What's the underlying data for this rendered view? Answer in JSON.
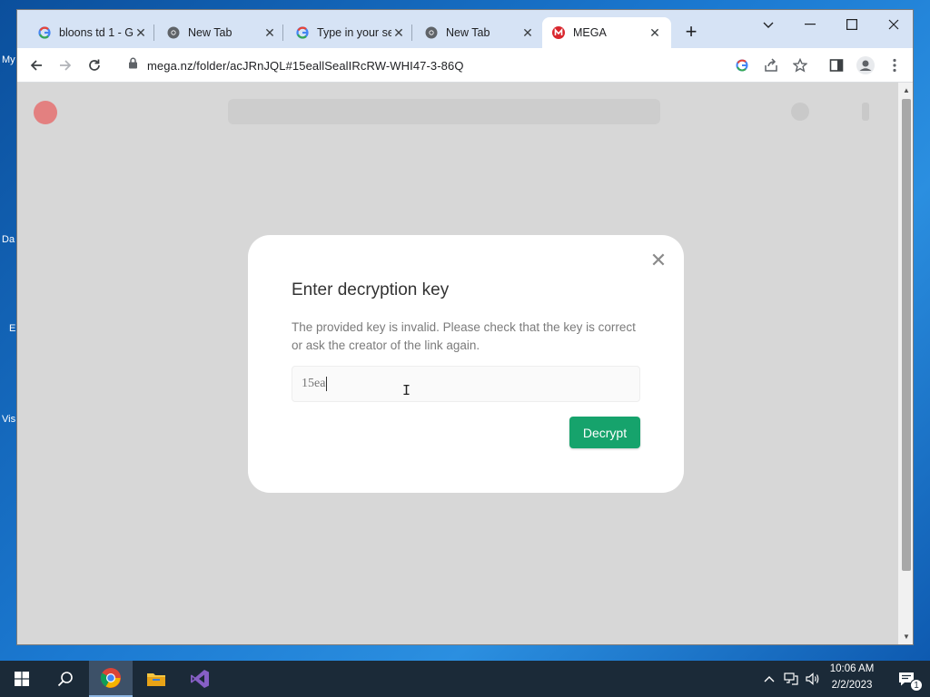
{
  "desktop": {
    "icon_labels": [
      "My",
      "Da",
      "E",
      "Vis"
    ]
  },
  "browser": {
    "tabs": [
      {
        "title": "bloons td 1 - G",
        "icon": "google-g-icon"
      },
      {
        "title": "New Tab",
        "icon": "chrome-icon"
      },
      {
        "title": "Type in your se",
        "icon": "google-g-icon"
      },
      {
        "title": "New Tab",
        "icon": "chrome-icon"
      },
      {
        "title": "MEGA",
        "icon": "mega-icon",
        "active": true
      }
    ],
    "new_tab_symbol": "+",
    "address": "mega.nz/folder/acJRnJQL#15eallSealIRcRW-WHI47-3-86Q"
  },
  "dialog": {
    "title": "Enter decryption key",
    "message": "The provided key is invalid. Please check that the key is correct or ask the creator of the link again.",
    "key_value": "15ea",
    "decrypt_label": "Decrypt",
    "close_symbol": "✕"
  },
  "taskbar": {
    "time": "10:06 AM",
    "date": "2/2/2023",
    "notification_count": "1"
  },
  "colors": {
    "accent_green": "#16a36c",
    "mega_red": "#d9272e",
    "taskbar": "#1b2a38"
  }
}
